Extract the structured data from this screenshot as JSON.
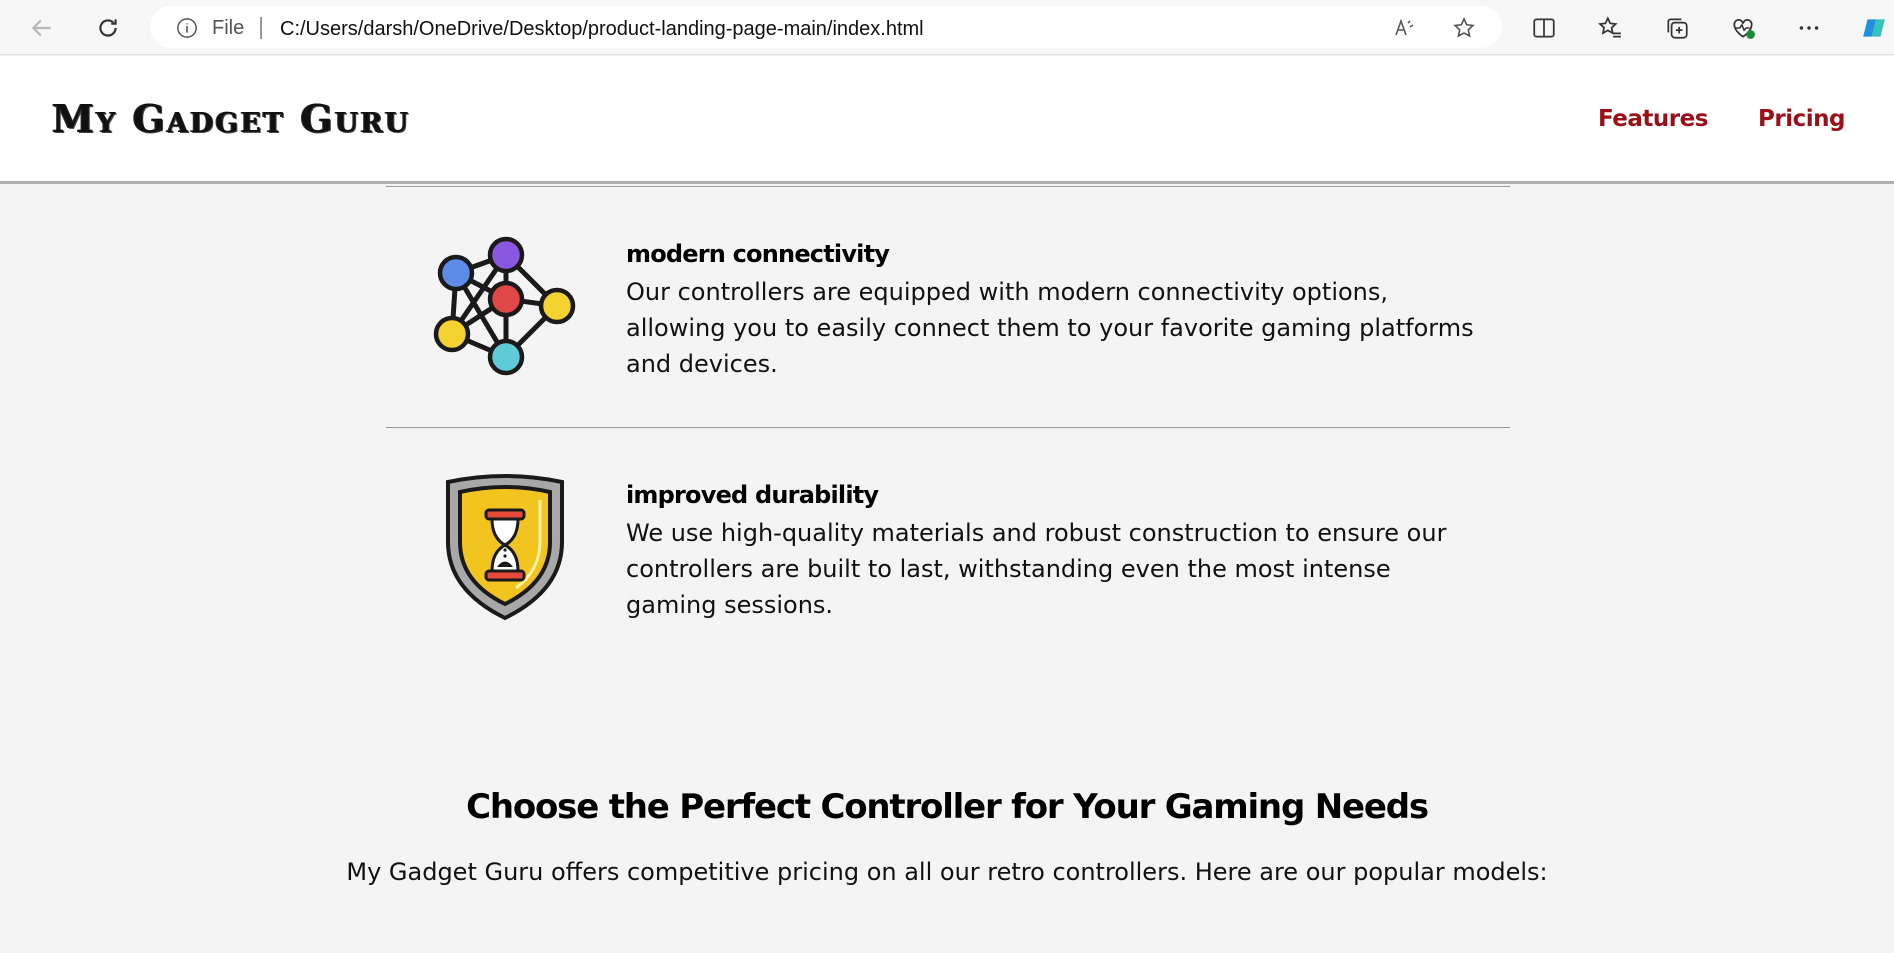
{
  "browser": {
    "file_label": "File",
    "url": "C:/Users/darsh/OneDrive/Desktop/product-landing-page-main/index.html",
    "icons": [
      "back-arrow-icon",
      "refresh-icon",
      "info-icon",
      "read-aloud-icon",
      "favorite-star-icon",
      "split-screen-icon",
      "favorites-icon",
      "collections-icon",
      "browser-health-icon",
      "more-options-icon",
      "copilot-icon"
    ]
  },
  "site": {
    "logo": "My Gadget Guru",
    "nav": [
      {
        "label": "Features"
      },
      {
        "label": "Pricing"
      }
    ],
    "nav_color": "#9b1018"
  },
  "features": [
    {
      "title": "Modern Connectivity",
      "description": "Our controllers are equipped with modern connectivity options, allowing you to easily connect them to your favorite gaming platforms and devices.",
      "icon": "network-nodes-icon"
    },
    {
      "title": "Improved Durability",
      "description": "We use high-quality materials and robust construction to ensure our controllers are built to last, withstanding even the most intense gaming sessions.",
      "icon": "shield-hourglass-icon"
    }
  ],
  "pricing": {
    "title": "Choose the Perfect Controller for Your Gaming Needs",
    "description": "My Gadget Guru offers competitive pricing on all our retro controllers. Here are our popular models:"
  }
}
